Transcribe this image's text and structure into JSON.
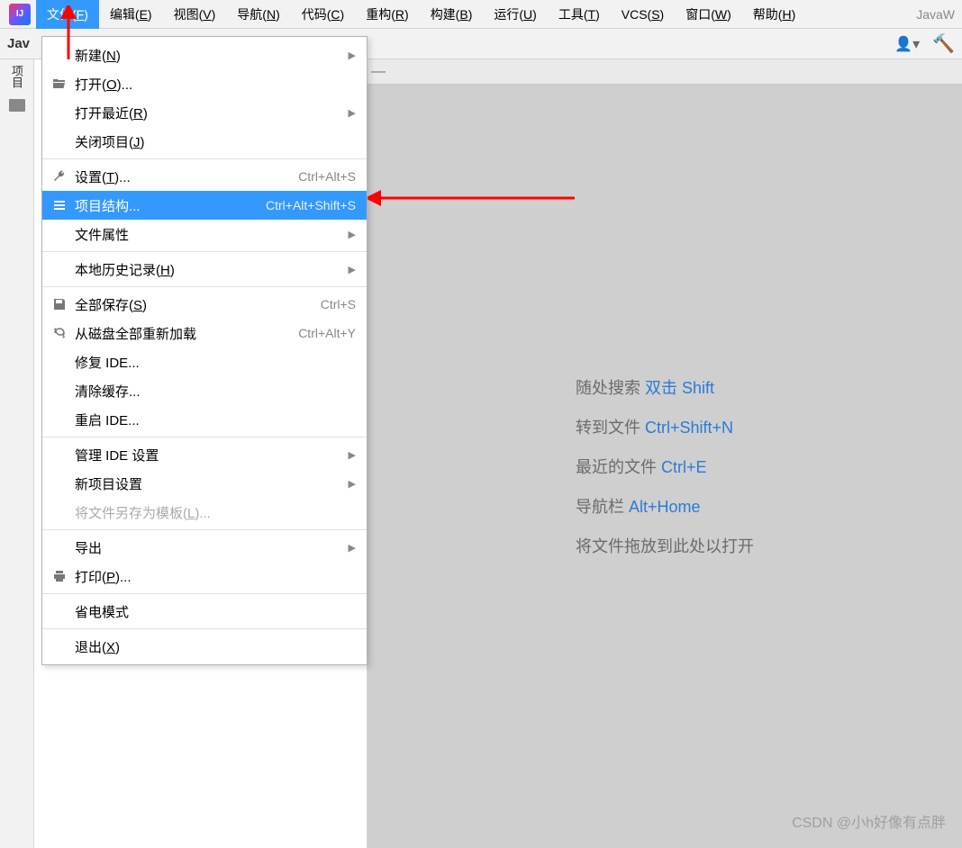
{
  "app_icon_text": "IJ",
  "menubar": [
    {
      "label": "文件",
      "mn": "F",
      "active": true
    },
    {
      "label": "编辑",
      "mn": "E"
    },
    {
      "label": "视图",
      "mn": "V"
    },
    {
      "label": "导航",
      "mn": "N"
    },
    {
      "label": "代码",
      "mn": "C"
    },
    {
      "label": "重构",
      "mn": "R"
    },
    {
      "label": "构建",
      "mn": "B"
    },
    {
      "label": "运行",
      "mn": "U"
    },
    {
      "label": "工具",
      "mn": "T"
    },
    {
      "label": "VCS",
      "mn": "S"
    },
    {
      "label": "窗口",
      "mn": "W"
    },
    {
      "label": "帮助",
      "mn": "H"
    }
  ],
  "title_right": "JavaW",
  "toolbar_left_text": "Jav",
  "sidebar": {
    "label": "项目"
  },
  "file_menu": [
    {
      "type": "item",
      "label": "新建",
      "mn": "N",
      "submenu": true
    },
    {
      "type": "item",
      "icon": "folder-open",
      "label": "打开",
      "mn": "O",
      "ellipsis": true
    },
    {
      "type": "item",
      "label": "打开最近",
      "mn": "R",
      "submenu": true
    },
    {
      "type": "item",
      "label": "关闭项目",
      "mn": "J"
    },
    {
      "type": "sep"
    },
    {
      "type": "item",
      "icon": "wrench",
      "label": "设置",
      "mn": "T",
      "ellipsis": true,
      "shortcut": "Ctrl+Alt+S"
    },
    {
      "type": "item",
      "icon": "structure",
      "label": "项目结构",
      "ellipsis": true,
      "shortcut": "Ctrl+Alt+Shift+S",
      "highlight": true
    },
    {
      "type": "item",
      "label": "文件属性",
      "submenu": true
    },
    {
      "type": "sep"
    },
    {
      "type": "item",
      "label": "本地历史记录",
      "mn": "H",
      "submenu": true
    },
    {
      "type": "sep"
    },
    {
      "type": "item",
      "icon": "save",
      "label": "全部保存",
      "mn": "S",
      "shortcut": "Ctrl+S"
    },
    {
      "type": "item",
      "icon": "reload",
      "label": "从磁盘全部重新加载",
      "shortcut": "Ctrl+Alt+Y"
    },
    {
      "type": "item",
      "label": "修复 IDE",
      "ellipsis": true
    },
    {
      "type": "item",
      "label": "清除缓存",
      "ellipsis": true
    },
    {
      "type": "item",
      "label": "重启 IDE",
      "ellipsis": true
    },
    {
      "type": "sep"
    },
    {
      "type": "item",
      "label": "管理 IDE 设置",
      "submenu": true
    },
    {
      "type": "item",
      "label": "新项目设置",
      "submenu": true
    },
    {
      "type": "item",
      "label": "将文件另存为模板",
      "mn": "L",
      "ellipsis": true,
      "disabled": true
    },
    {
      "type": "sep"
    },
    {
      "type": "item",
      "label": "导出",
      "submenu": true
    },
    {
      "type": "item",
      "icon": "print",
      "label": "打印",
      "mn": "P",
      "ellipsis": true
    },
    {
      "type": "sep"
    },
    {
      "type": "item",
      "label": "省电模式"
    },
    {
      "type": "sep"
    },
    {
      "type": "item",
      "label": "退出",
      "mn": "X"
    }
  ],
  "hints": [
    {
      "text": "随处搜索",
      "kbd": "双击 Shift"
    },
    {
      "text": "转到文件",
      "kbd": "Ctrl+Shift+N"
    },
    {
      "text": "最近的文件",
      "kbd": "Ctrl+E"
    },
    {
      "text": "导航栏",
      "kbd": "Alt+Home"
    },
    {
      "text": "将文件拖放到此处以打开",
      "kbd": ""
    }
  ],
  "watermark": "CSDN @小h好像有点胖"
}
